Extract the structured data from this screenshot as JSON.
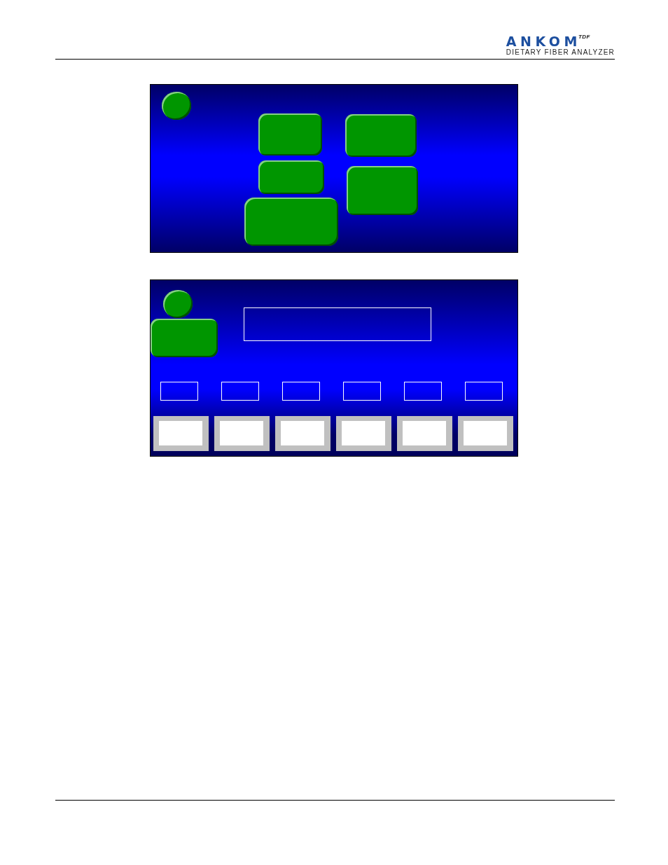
{
  "header": {
    "logo": {
      "wordmark": "ANKOM$^{TDF}$",
      "tagline": "DIETARY FIBER ANALYZER"
    }
  },
  "screens": [
    {
      "kind": "menu"
    },
    {
      "kind": "entry"
    }
  ]
}
